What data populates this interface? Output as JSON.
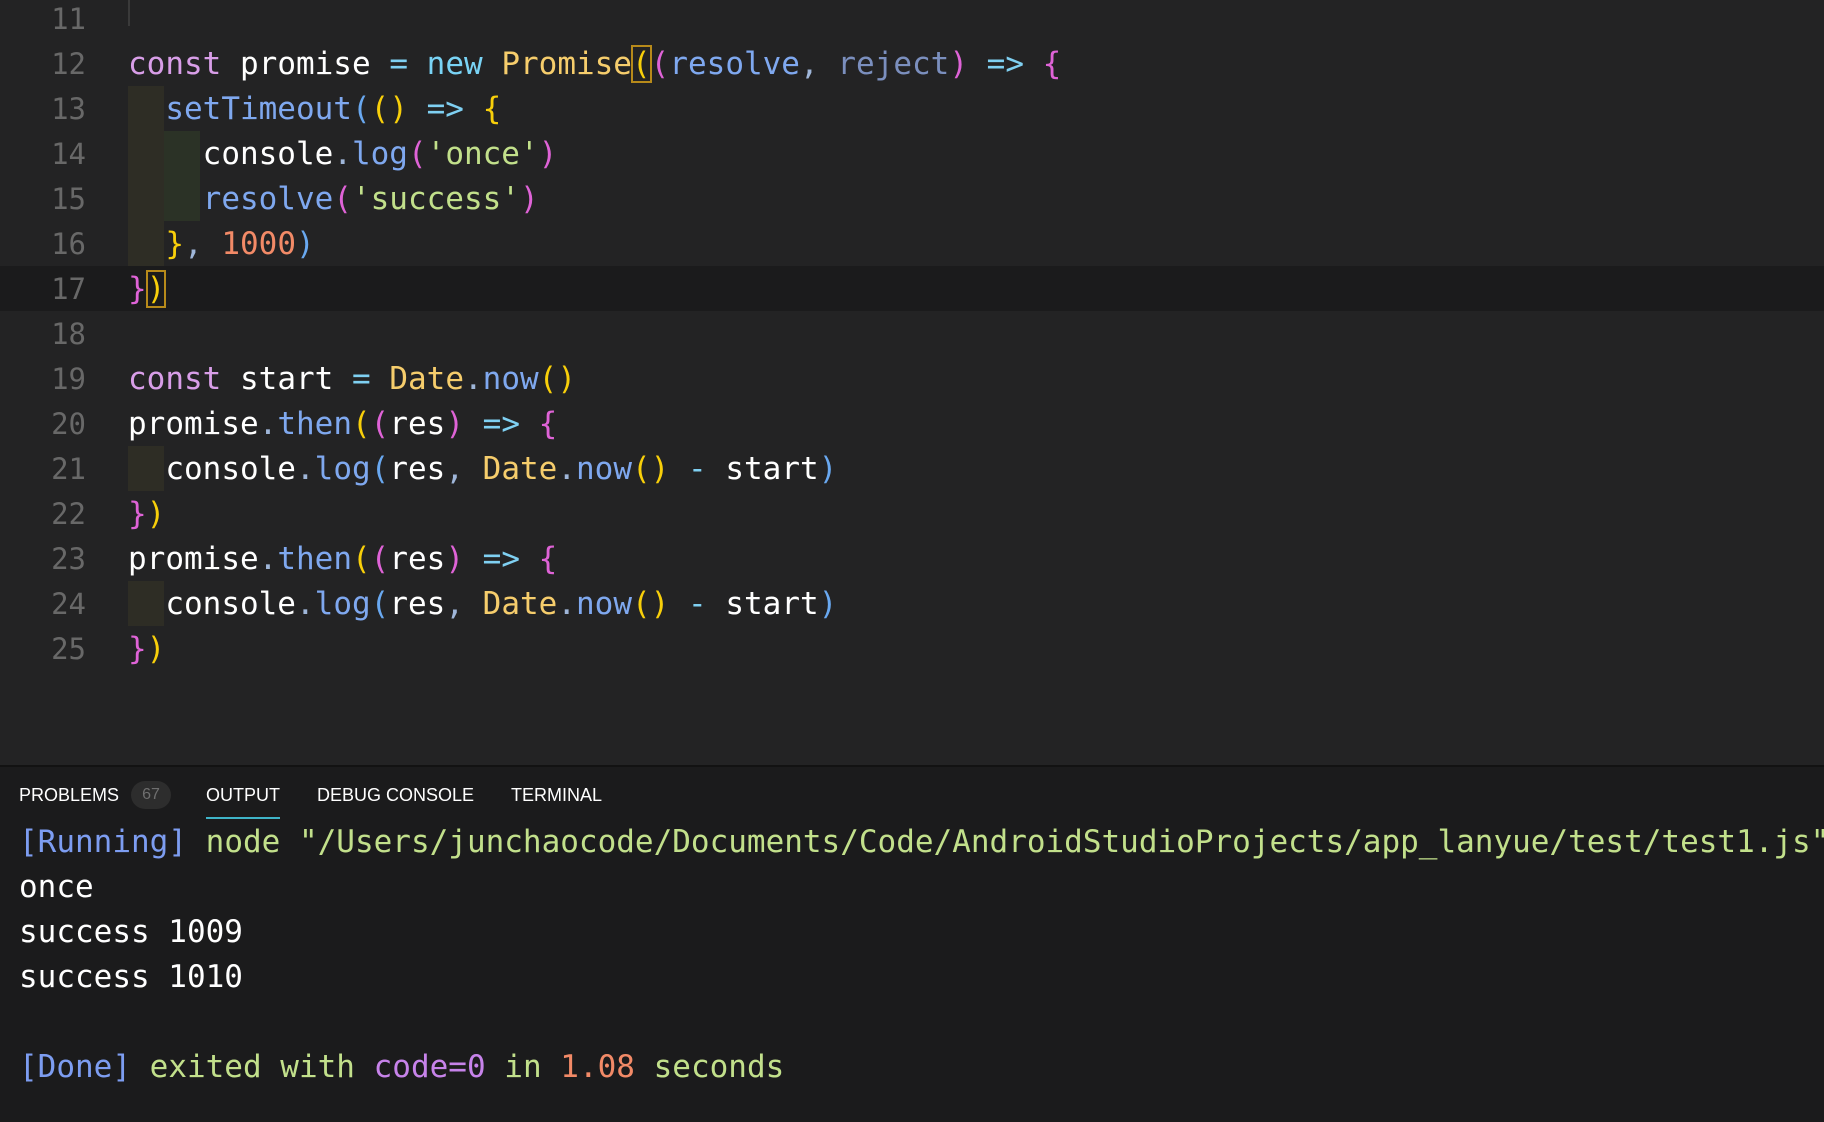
{
  "editor": {
    "lines": [
      {
        "n": "11",
        "tokens": []
      },
      {
        "n": "12",
        "tokens": [
          [
            "kw",
            "const"
          ],
          [
            "",
            "  promise "
          ],
          [
            "op",
            "="
          ],
          [
            "",
            " "
          ],
          [
            "kw2",
            "new"
          ],
          [
            "",
            " "
          ],
          [
            "cls",
            "Promise"
          ],
          [
            "b1",
            "("
          ],
          [
            "b2",
            "("
          ],
          [
            "fn",
            "resolve"
          ],
          [
            "pu",
            ","
          ],
          [
            "",
            " "
          ],
          [
            "prm",
            "reject"
          ],
          [
            "b2",
            ")"
          ],
          [
            "",
            " "
          ],
          [
            "op",
            "=>"
          ],
          [
            "",
            " "
          ],
          [
            "b2",
            "{"
          ]
        ]
      },
      {
        "n": "13",
        "tokens": [
          [
            "",
            "  "
          ],
          [
            "fn",
            "setTimeout"
          ],
          [
            "b3",
            "("
          ],
          [
            "b1",
            "()"
          ],
          [
            "",
            " "
          ],
          [
            "op",
            "=>"
          ],
          [
            "",
            " "
          ],
          [
            "b1",
            "{"
          ]
        ]
      },
      {
        "n": "14",
        "tokens": [
          [
            "",
            "    console"
          ],
          [
            "pu",
            "."
          ],
          [
            "fn",
            "log"
          ],
          [
            "b2",
            "("
          ],
          [
            "str",
            "'once'"
          ],
          [
            "b2",
            ")"
          ]
        ]
      },
      {
        "n": "15",
        "tokens": [
          [
            "",
            "    "
          ],
          [
            "fn",
            "resolve"
          ],
          [
            "b2",
            "("
          ],
          [
            "str",
            "'success'"
          ],
          [
            "b2",
            ")"
          ]
        ]
      },
      {
        "n": "16",
        "tokens": [
          [
            "",
            "  "
          ],
          [
            "b1",
            "}"
          ],
          [
            "pu",
            ","
          ],
          [
            "",
            " "
          ],
          [
            "num",
            "1000"
          ],
          [
            "b3",
            ")"
          ]
        ]
      },
      {
        "n": "17",
        "tokens": [
          [
            "b2",
            "}"
          ],
          [
            "b1",
            ")"
          ]
        ]
      },
      {
        "n": "18",
        "tokens": []
      },
      {
        "n": "19",
        "tokens": [
          [
            "kw",
            "const"
          ],
          [
            "",
            " start "
          ],
          [
            "op",
            "="
          ],
          [
            "",
            " "
          ],
          [
            "cls",
            "Date"
          ],
          [
            "pu",
            "."
          ],
          [
            "fn",
            "now"
          ],
          [
            "b1",
            "()"
          ]
        ]
      },
      {
        "n": "20",
        "tokens": [
          [
            "",
            "promise"
          ],
          [
            "pu",
            "."
          ],
          [
            "fn",
            "then"
          ],
          [
            "b1",
            "("
          ],
          [
            "b2",
            "("
          ],
          [
            "",
            "res"
          ],
          [
            "b2",
            ")"
          ],
          [
            "",
            " "
          ],
          [
            "op",
            "=>"
          ],
          [
            "",
            " "
          ],
          [
            "b2",
            "{"
          ]
        ]
      },
      {
        "n": "21",
        "tokens": [
          [
            "",
            "  console"
          ],
          [
            "pu",
            "."
          ],
          [
            "fn",
            "log"
          ],
          [
            "b3",
            "("
          ],
          [
            "",
            "res"
          ],
          [
            "pu",
            ","
          ],
          [
            "",
            " "
          ],
          [
            "cls",
            "Date"
          ],
          [
            "pu",
            "."
          ],
          [
            "fn",
            "now"
          ],
          [
            "b1",
            "()"
          ],
          [
            "",
            " "
          ],
          [
            "op",
            "-"
          ],
          [
            "",
            " start"
          ],
          [
            "b3",
            ")"
          ]
        ]
      },
      {
        "n": "22",
        "tokens": [
          [
            "b2",
            "}"
          ],
          [
            "b1",
            ")"
          ]
        ]
      },
      {
        "n": "23",
        "tokens": [
          [
            "",
            "promise"
          ],
          [
            "pu",
            "."
          ],
          [
            "fn",
            "then"
          ],
          [
            "b1",
            "("
          ],
          [
            "b2",
            "("
          ],
          [
            "",
            "res"
          ],
          [
            "b2",
            ")"
          ],
          [
            "",
            " "
          ],
          [
            "op",
            "=>"
          ],
          [
            "",
            " "
          ],
          [
            "b2",
            "{"
          ]
        ]
      },
      {
        "n": "24",
        "tokens": [
          [
            "",
            "  console"
          ],
          [
            "pu",
            "."
          ],
          [
            "fn",
            "log"
          ],
          [
            "b3",
            "("
          ],
          [
            "",
            "res"
          ],
          [
            "pu",
            ","
          ],
          [
            "",
            " "
          ],
          [
            "cls",
            "Date"
          ],
          [
            "pu",
            "."
          ],
          [
            "fn",
            "now"
          ],
          [
            "b1",
            "()"
          ],
          [
            "",
            " "
          ],
          [
            "op",
            "-"
          ],
          [
            "",
            " start"
          ],
          [
            "b3",
            ")"
          ]
        ]
      },
      {
        "n": "25",
        "tokens": [
          [
            "b2",
            "}"
          ],
          [
            "b1",
            ")"
          ]
        ]
      }
    ]
  },
  "panel": {
    "tabs": [
      {
        "label": "PROBLEMS",
        "badge": "67"
      },
      {
        "label": "OUTPUT",
        "active": true
      },
      {
        "label": "DEBUG CONSOLE"
      },
      {
        "label": "TERMINAL"
      }
    ],
    "output": {
      "running_tag": "[Running]",
      "command": "node \"/Users/junchaocode/Documents/Code/AndroidStudioProjects/app_lanyue/test/test1.js\"",
      "lines": [
        "once",
        "success 1009",
        "success 1010"
      ],
      "done_tag": "[Done]",
      "done_text_1": "exited with",
      "done_code": "code=0",
      "done_text_2": "in",
      "done_time": "1.08",
      "done_text_3": "seconds"
    }
  }
}
